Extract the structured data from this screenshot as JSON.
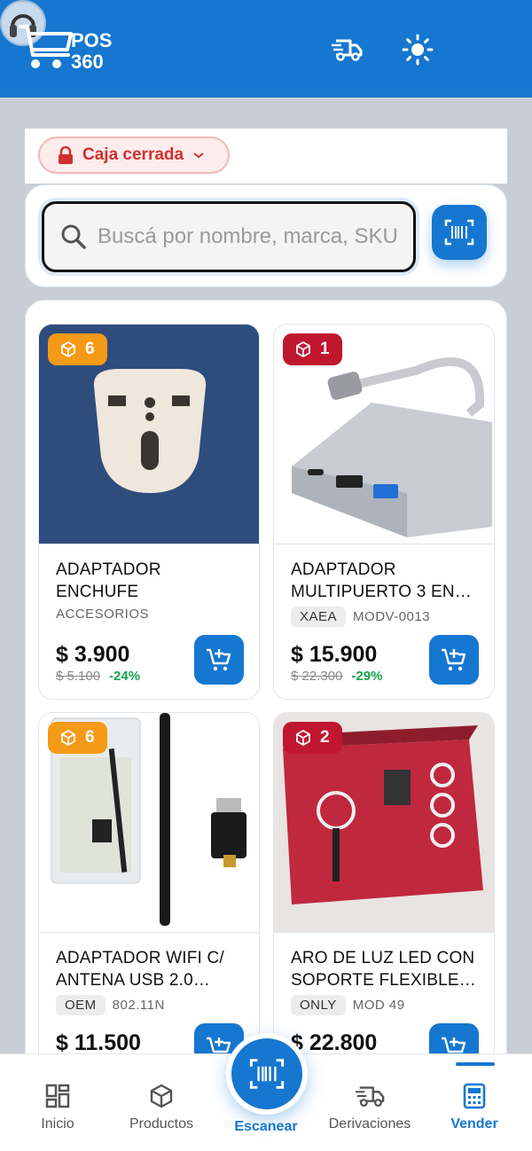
{
  "app": {
    "logo_line1": "POS",
    "logo_line2": "360"
  },
  "colors": {
    "primary": "#1677d0",
    "danger": "#d32f2f",
    "discount": "#18a34a",
    "badge_orange": "#f59a17",
    "badge_red": "#c0162f"
  },
  "header": {
    "icons": [
      "truck-icon",
      "sun-icon",
      "avatar"
    ]
  },
  "caja": {
    "label": "Caja cerrada",
    "icon": "lock-icon"
  },
  "search": {
    "placeholder": "Buscá por nombre, marca, SKU"
  },
  "products": [
    {
      "stock": "6",
      "stock_color": "orange",
      "name": "ADAPTADOR ENCHUFE",
      "tags": [],
      "category": "ACCESORIOS",
      "price": "$ 3.900",
      "old_price": "$ 5.100",
      "discount": "-24%"
    },
    {
      "stock": "1",
      "stock_color": "red",
      "name": "ADAPTADOR MULTIPUERTO 3 EN…",
      "tags": [
        "XAEA"
      ],
      "model": "MODV-0013",
      "price": "$ 15.900",
      "old_price": "$ 22.300",
      "discount": "-29%"
    },
    {
      "stock": "6",
      "stock_color": "orange",
      "name": "ADAPTADOR WIFI C/ ANTENA USB 2.0…",
      "tags": [
        "OEM"
      ],
      "model": "802.11N",
      "price": "$ 11.500",
      "old_price": "",
      "discount": ""
    },
    {
      "stock": "2",
      "stock_color": "red",
      "name": "ARO DE LUZ LED CON SOPORTE FLEXIBLE…",
      "tags": [
        "ONLY"
      ],
      "model": "MOD 49",
      "price": "$ 22.800",
      "old_price": "",
      "discount": ""
    }
  ],
  "nav": {
    "items": [
      {
        "label": "Inicio",
        "icon": "dashboard-icon"
      },
      {
        "label": "Productos",
        "icon": "box-icon"
      },
      {
        "label": "Escanear",
        "icon": "barcode-scan-icon"
      },
      {
        "label": "Derivaciones",
        "icon": "truck-icon"
      },
      {
        "label": "Vender",
        "icon": "calculator-icon"
      }
    ],
    "active": "Vender"
  }
}
